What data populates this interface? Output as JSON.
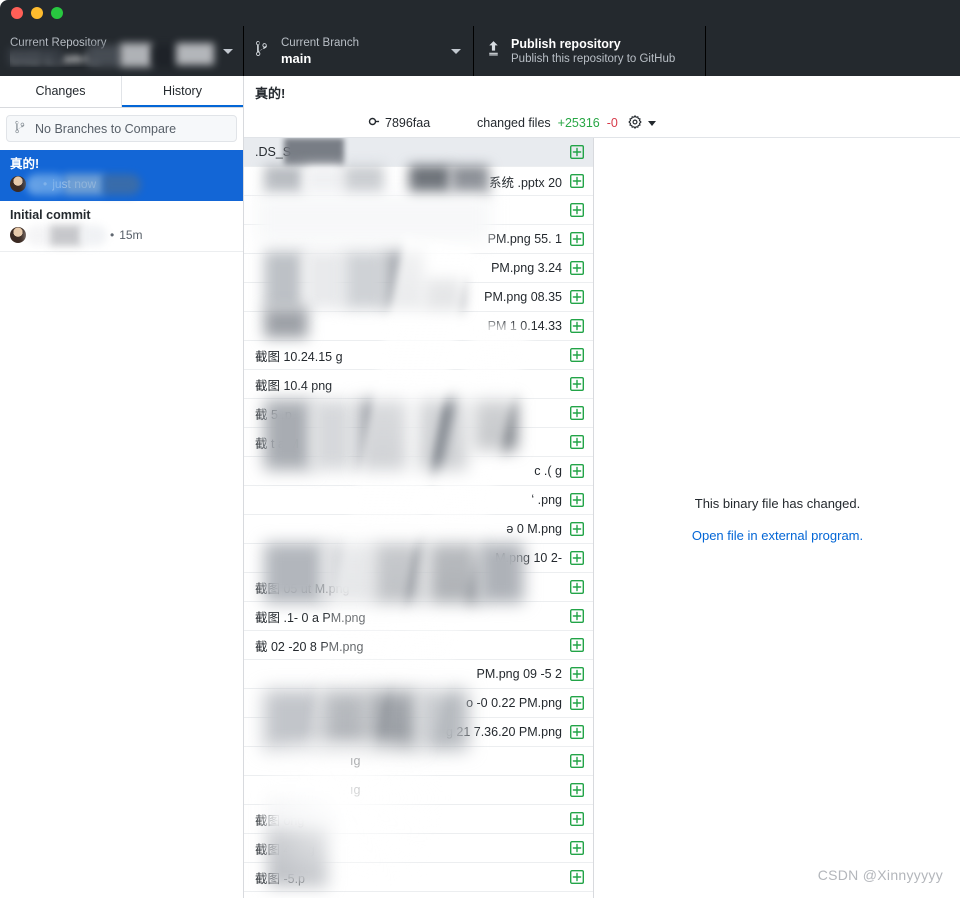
{
  "window": {
    "traffic_lights": [
      "close",
      "minimize",
      "maximize"
    ]
  },
  "toolbar": {
    "repo": {
      "label": "Current Repository",
      "value": "bh02-s...sm-l...",
      "icon": "repo-icon",
      "redacted": true
    },
    "branch": {
      "label": "Current Branch",
      "value": "main",
      "icon": "branch-icon"
    },
    "publish": {
      "label": "Publish repository",
      "sublabel": "Publish this repository to GitHub",
      "icon": "upload-icon"
    }
  },
  "sidebar": {
    "tabs": [
      {
        "label": "Changes",
        "active": false
      },
      {
        "label": "History",
        "active": true
      }
    ],
    "compare": {
      "label": "No Branches to Compare",
      "icon": "branch-icon"
    },
    "commits": [
      {
        "title": "真的!",
        "author": "y",
        "time": "just now",
        "separator": "•",
        "selected": true
      },
      {
        "title": "Initial commit",
        "author": "",
        "time": "15m",
        "separator": "•",
        "selected": false
      }
    ]
  },
  "commit_header": {
    "title": "真的!",
    "sha": "7896faa",
    "sha_icon": "commit-icon",
    "changed_files_label": "changed files",
    "additions": "+25316",
    "deletions": "-0",
    "gear_icon": "gear-icon"
  },
  "file_list": {
    "files": [
      {
        "name": ".DS_S",
        "status": "added",
        "selected": true
      },
      {
        "name": "20                    系统 .pptx",
        "status": "added",
        "selected": false
      },
      {
        "name": "",
        "status": "added",
        "selected": false
      },
      {
        "name": "1        .55 PM.png",
        "status": "added",
        "selected": false
      },
      {
        "name": "3.24 PM.png",
        "status": "added",
        "selected": false
      },
      {
        "name": "08.35 PM.png",
        "status": "added",
        "selected": false
      },
      {
        "name": "0.14.33 PM     1",
        "status": "added",
        "selected": false
      },
      {
        "name": "截图            10.24.15      g",
        "status": "added",
        "selected": false
      },
      {
        "name": "截图         10.4          png",
        "status": "added",
        "selected": false
      },
      {
        "name": "截                        5      .p",
        "status": "added",
        "selected": false
      },
      {
        "name": "截                t          a      M",
        "status": "added",
        "selected": false
      },
      {
        "name": "c              .(              g",
        "status": "added",
        "selected": false
      },
      {
        "name": "ʻ              .png",
        "status": "added",
        "selected": false
      },
      {
        "name": "ə           0            M.png",
        "status": "added",
        "selected": false
      },
      {
        "name": "-2      10          M.png",
        "status": "added",
        "selected": false
      },
      {
        "name": "截图        05      ut      M.png",
        "status": "added",
        "selected": false
      },
      {
        "name": "截图      .1-      0 a      PM.png",
        "status": "added",
        "selected": false
      },
      {
        "name": "截          02      -20        8 PM.png",
        "status": "added",
        "selected": false
      },
      {
        "name": "2      5-      09 PM.png",
        "status": "added",
        "selected": false
      },
      {
        "name": "o      -0      0.22 PM.png",
        "status": "added",
        "selected": false
      },
      {
        "name": "g      21        7.36.20 PM.png",
        "status": "added",
        "selected": false
      },
      {
        "name": "ıg",
        "status": "added",
        "selected": false
      },
      {
        "name": "ıg",
        "status": "added",
        "selected": false
      },
      {
        "name": "截图        ong",
        "status": "added",
        "selected": false
      },
      {
        "name": "截图      4.png",
        "status": "added",
        "selected": false
      },
      {
        "name": "截图      -5.p",
        "status": "added",
        "selected": false
      }
    ]
  },
  "diff_panel": {
    "binary_message": "This binary file has changed.",
    "open_external_link": "Open file in external program."
  },
  "watermark": {
    "text": "CSDN @Xinnyyyyy"
  },
  "colors": {
    "toolbar_bg": "#24292e",
    "accent_blue": "#0366d6",
    "selected_commit": "#1366d6",
    "addition_green": "#28a745",
    "deletion_red": "#d73a49",
    "link_blue": "#0366d6"
  }
}
